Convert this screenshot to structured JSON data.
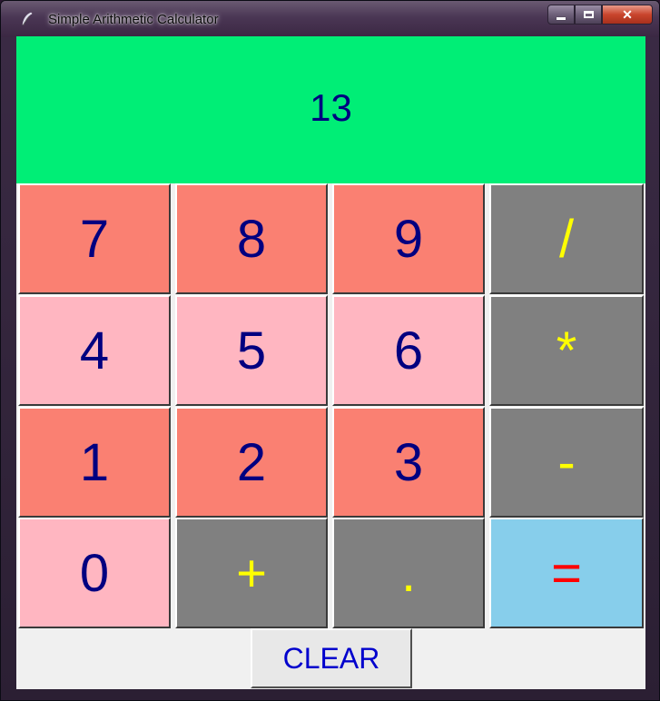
{
  "window": {
    "title": "Simple Arithmetic Calculator",
    "minimize_label": "",
    "maximize_label": "",
    "close_label": "✕"
  },
  "display": {
    "value": "13",
    "background_color": "#00ee76",
    "text_color": "#000080"
  },
  "keys": {
    "k7": "7",
    "k8": "8",
    "k9": "9",
    "div": "/",
    "k4": "4",
    "k5": "5",
    "k6": "6",
    "mul": "*",
    "k1": "1",
    "k2": "2",
    "k3": "3",
    "sub": "-",
    "k0": "0",
    "add": "+",
    "dot": ".",
    "eq": "="
  },
  "clear_label": "CLEAR",
  "colors": {
    "salmon_key": "#fa8072",
    "pink_key": "#ffb6c1",
    "operator_key": "#808080",
    "equals_key": "#87ceeb",
    "digit_text": "#000080",
    "operator_text": "#ffff00",
    "equals_text": "#ff0000",
    "clear_text": "#0000cd"
  }
}
